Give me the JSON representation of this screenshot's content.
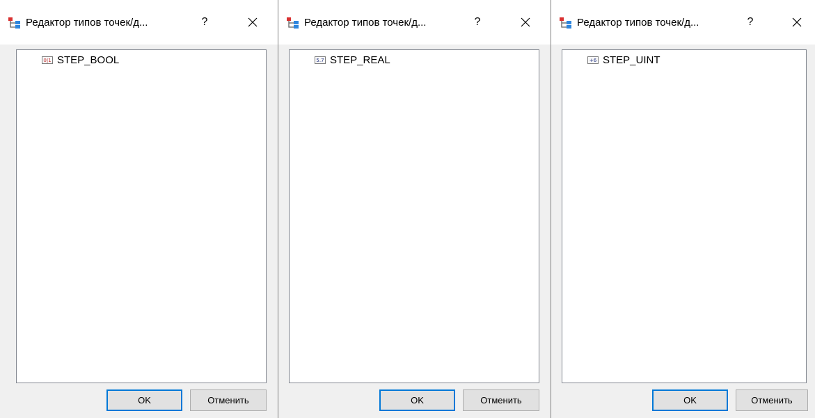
{
  "dialogs": [
    {
      "title": "Редактор типов точек/д...",
      "help_label": "?",
      "item_label": "STEP_BOOL",
      "item_icon_text": "0|1",
      "item_icon": "bool-type-icon",
      "ok_label": "OK",
      "cancel_label": "Отменить"
    },
    {
      "title": "Редактор типов точек/д...",
      "help_label": "?",
      "item_label": "STEP_REAL",
      "item_icon_text": "5.7",
      "item_icon": "real-type-icon",
      "ok_label": "OK",
      "cancel_label": "Отменить"
    },
    {
      "title": "Редактор типов точек/д...",
      "help_label": "?",
      "item_label": "STEP_UINT",
      "item_icon_text": "+6",
      "item_icon": "uint-type-icon",
      "ok_label": "OK",
      "cancel_label": "Отменить"
    }
  ],
  "colors": {
    "accent": "#0078d7",
    "titlebar": "#ffffff",
    "window": "#f0f0f0"
  }
}
